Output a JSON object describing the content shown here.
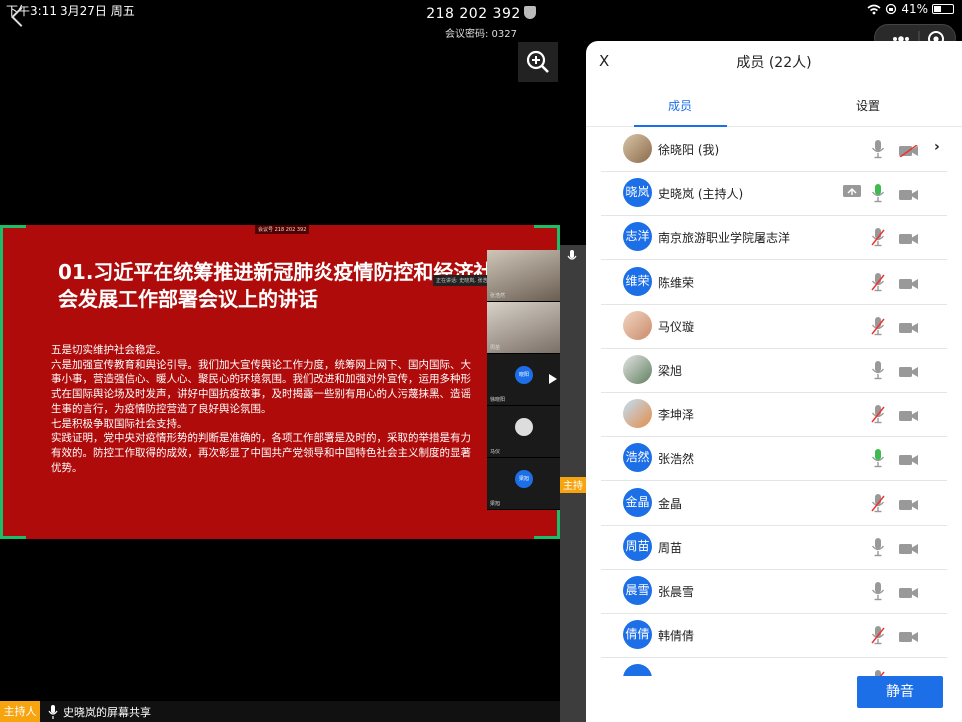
{
  "status_bar": {
    "time": "下午3:11",
    "date": "3月27日 周五",
    "battery": "41%",
    "battery_level": 0.41
  },
  "meeting": {
    "id": "218 202 392",
    "password_label": "会议密码: 0327"
  },
  "slide": {
    "recording_tag": "会议号 218 202 392",
    "speaking_tag": "正在讲话: 史晓岚, 张浩然",
    "title": "01.习近平在统筹推进新冠肺炎疫情防控和经济社会发展工作部署会议上的讲话",
    "body": [
      "五是切实维护社会稳定。",
      "六是加强宣传教育和舆论引导。我们加大宣传舆论工作力度，统筹网上网下、国内国际、大事小事，营造强信心、暖人心、聚民心的环境氛围。我们改进和加强对外宣传，运用多种形式在国际舆论场及时发声，讲好中国抗疫故事，及时揭露一些别有用心的人污蔑抹黑、造谣生事的言行，为疫情防控营造了良好舆论氛围。",
      "七是积极争取国际社会支持。",
      "实践证明，党中央对疫情形势的判断是准确的，各项工作部署是及时的，采取的举措是有力有效的。防控工作取得的成效，再次彰显了中国共产党领导和中国特色社会主义制度的显著优势。"
    ],
    "mini_tiles": [
      {
        "name": "张浩然",
        "avatar_text": ""
      },
      {
        "name": "周苗",
        "avatar_text": ""
      },
      {
        "name": "徐晓阳",
        "avatar_text": "晓阳"
      },
      {
        "name": "马仪",
        "avatar_text": ""
      },
      {
        "name": "梁旭",
        "avatar_text": "梁旭"
      }
    ]
  },
  "strip": {
    "host_tag": "主持"
  },
  "bottom_bar": {
    "host_label": "主持人",
    "status": "史晓岚的屏幕共享"
  },
  "panel": {
    "close": "X",
    "title": "成员 (22人)",
    "tabs": [
      "成员",
      "设置"
    ],
    "members": [
      {
        "avatar": "",
        "avatar_style": "photo",
        "name": "徐晓阳 (我)",
        "mic": "on",
        "cam": "off",
        "chevron": true
      },
      {
        "avatar": "晓岚",
        "avatar_style": "text",
        "name": "史晓岚 (主持人)",
        "mic": "on-green",
        "cam": "on",
        "sharing": true
      },
      {
        "avatar": "志洋",
        "avatar_style": "text",
        "name": "南京旅游职业学院屠志洋",
        "mic": "muted",
        "cam": "on"
      },
      {
        "avatar": "维荣",
        "avatar_style": "text",
        "name": "陈维荣",
        "mic": "muted",
        "cam": "on"
      },
      {
        "avatar": "",
        "avatar_style": "photo2",
        "name": "马仪璇",
        "mic": "muted",
        "cam": "on"
      },
      {
        "avatar": "",
        "avatar_style": "photo3",
        "name": "梁旭",
        "mic": "on",
        "cam": "on"
      },
      {
        "avatar": "",
        "avatar_style": "photo4",
        "name": "李坤泽",
        "mic": "muted",
        "cam": "on"
      },
      {
        "avatar": "浩然",
        "avatar_style": "text",
        "name": "张浩然",
        "mic": "on-green",
        "cam": "on"
      },
      {
        "avatar": "金晶",
        "avatar_style": "text",
        "name": "金晶",
        "mic": "muted",
        "cam": "on"
      },
      {
        "avatar": "周苗",
        "avatar_style": "text",
        "name": "周苗",
        "mic": "on",
        "cam": "on"
      },
      {
        "avatar": "晨雪",
        "avatar_style": "text",
        "name": "张晨雪",
        "mic": "on",
        "cam": "on"
      },
      {
        "avatar": "倩倩",
        "avatar_style": "text",
        "name": "韩倩倩",
        "mic": "muted",
        "cam": "on"
      },
      {
        "avatar": "",
        "avatar_style": "text",
        "name": "",
        "mic": "muted",
        "cam": "on"
      }
    ],
    "mute_button": "静音"
  },
  "colors": {
    "accent": "#1d6fe8",
    "host": "#f6a40f",
    "slide_bg": "#b00b0b",
    "frame": "#1bbf6a"
  }
}
